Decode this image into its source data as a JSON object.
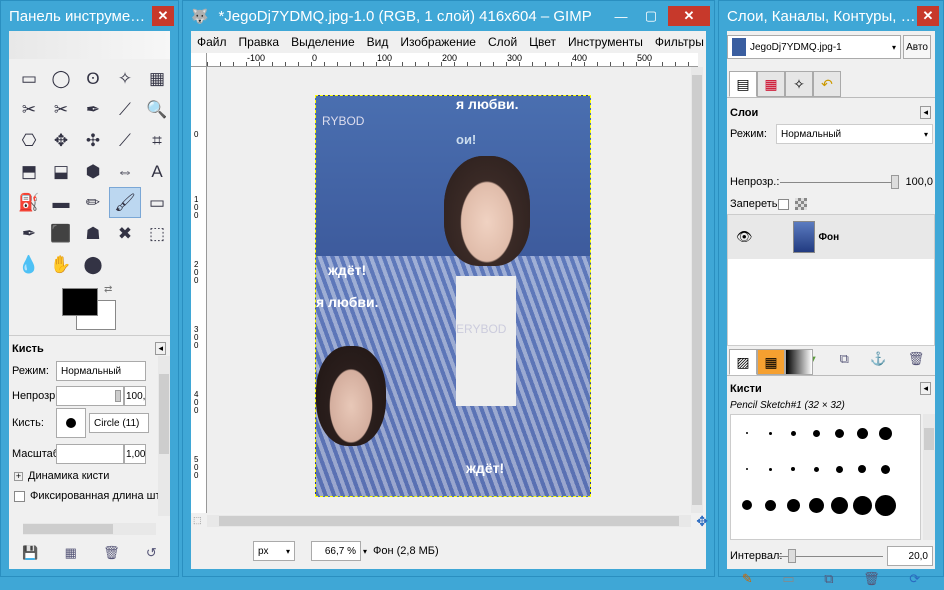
{
  "toolbox": {
    "title": "Панель инструме…",
    "tools": [
      "▭",
      "◯",
      "ʘ",
      "✧",
      "▦",
      "✂",
      "✂",
      "✒",
      "⟋",
      "🔍",
      "⎔",
      "✥",
      "✣",
      "⟋",
      "⌗",
      "⬒",
      "⬓",
      "⬢",
      "⇔",
      "A",
      "⛽",
      "▬",
      "✏",
      "🖌",
      "▭",
      "✒",
      "⬛",
      "☗",
      "✖",
      "⬚",
      "💧",
      "✋",
      "⬤",
      "",
      ""
    ],
    "tool_options_title": "Кисть",
    "mode_label": "Режим:",
    "mode_value": "Нормальный",
    "opacity_label": "Непрозр.:",
    "opacity_value": "100,",
    "brush_label": "Кисть:",
    "brush_value": "Circle (11)",
    "scale_label": "Масштаб:",
    "scale_value": "1,00",
    "dynamics_label": "Динамика кисти",
    "fixed_length_label": "Фиксированная длина шт"
  },
  "main": {
    "title": "*JegoDj7YDMQ.jpg-1.0 (RGB, 1 слой) 416x604 – GIMP",
    "menus": [
      "Файл",
      "Правка",
      "Выделение",
      "Вид",
      "Изображение",
      "Слой",
      "Цвет",
      "Инструменты",
      "Фильтры"
    ],
    "ruler_labels": [
      "-100",
      "0",
      "100",
      "200",
      "300",
      "400",
      "500"
    ],
    "ruler_v_labels": [
      "0",
      "1 0 0",
      "2 0 0",
      "3 0 0",
      "4 0 0",
      "5 0 0"
    ],
    "unit": "px",
    "zoom": "66,7 %",
    "status": "Фон (2,8 МБ)",
    "photo_texts": [
      "я любви.",
      "RYBOD",
      "ои!",
      "ждёт!",
      "я любви.",
      "ERYBOD",
      "ждёт!"
    ]
  },
  "layers": {
    "title": "Слои, Каналы, Контуры, …",
    "image_name": "JegoDj7YDMQ.jpg-1",
    "auto_label": "Авто",
    "panel_title": "Слои",
    "mode_label": "Режим:",
    "mode_value": "Нормальный",
    "opacity_label": "Непрозр.:",
    "opacity_value": "100,0",
    "lock_label": "Запереть:",
    "layer_name": "Фон",
    "brushes_title": "Кисти",
    "brush_name": "Pencil Sketch#1 (32 × 32)",
    "spacing_label": "Интервал:",
    "spacing_value": "20,0"
  },
  "colors": {
    "titlebar": "#3fa7d6",
    "close": "#c7392b"
  }
}
